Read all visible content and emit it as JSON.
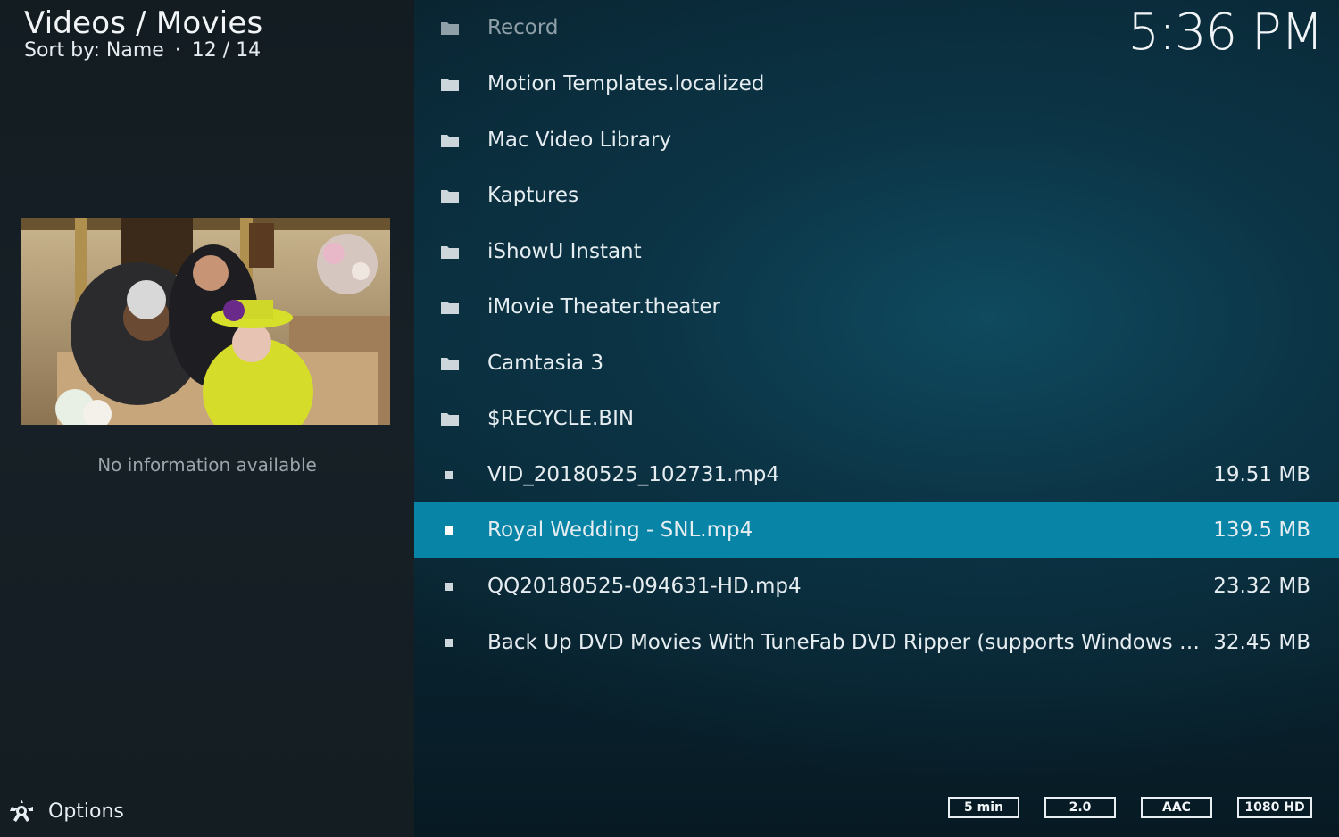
{
  "header": {
    "title": "Videos / Movies",
    "sort_label": "Sort by: Name",
    "separator": "·",
    "position": "12 / 14"
  },
  "clock": "5:36 PM",
  "preview": {
    "info_text": "No information available"
  },
  "options": {
    "label": "Options",
    "icon": "options-gear-icon"
  },
  "items": [
    {
      "label": "Record",
      "type": "folder",
      "size": ""
    },
    {
      "label": "Motion Templates.localized",
      "type": "folder",
      "size": ""
    },
    {
      "label": "Mac Video Library",
      "type": "folder",
      "size": ""
    },
    {
      "label": "Kaptures",
      "type": "folder",
      "size": ""
    },
    {
      "label": "iShowU Instant",
      "type": "folder",
      "size": ""
    },
    {
      "label": "iMovie Theater.theater",
      "type": "folder",
      "size": ""
    },
    {
      "label": "Camtasia 3",
      "type": "folder",
      "size": ""
    },
    {
      "label": "$RECYCLE.BIN",
      "type": "folder",
      "size": ""
    },
    {
      "label": "VID_20180525_102731.mp4",
      "type": "file",
      "size": "19.51 MB"
    },
    {
      "label": "Royal Wedding - SNL.mp4",
      "type": "file",
      "size": "139.5 MB",
      "focused": true
    },
    {
      "label": "QQ20180525-094631-HD.mp4",
      "type": "file",
      "size": "23.32 MB"
    },
    {
      "label": "Back Up DVD Movies With TuneFab DVD Ripper (supports Windows and Ma...",
      "type": "file",
      "size": "32.45 MB"
    }
  ],
  "badges": [
    "5 min",
    "2.0",
    "AAC",
    "1080 HD"
  ],
  "colors": {
    "focus": "#0784a6",
    "left_panel": "#162026",
    "background": "#0b3344"
  }
}
